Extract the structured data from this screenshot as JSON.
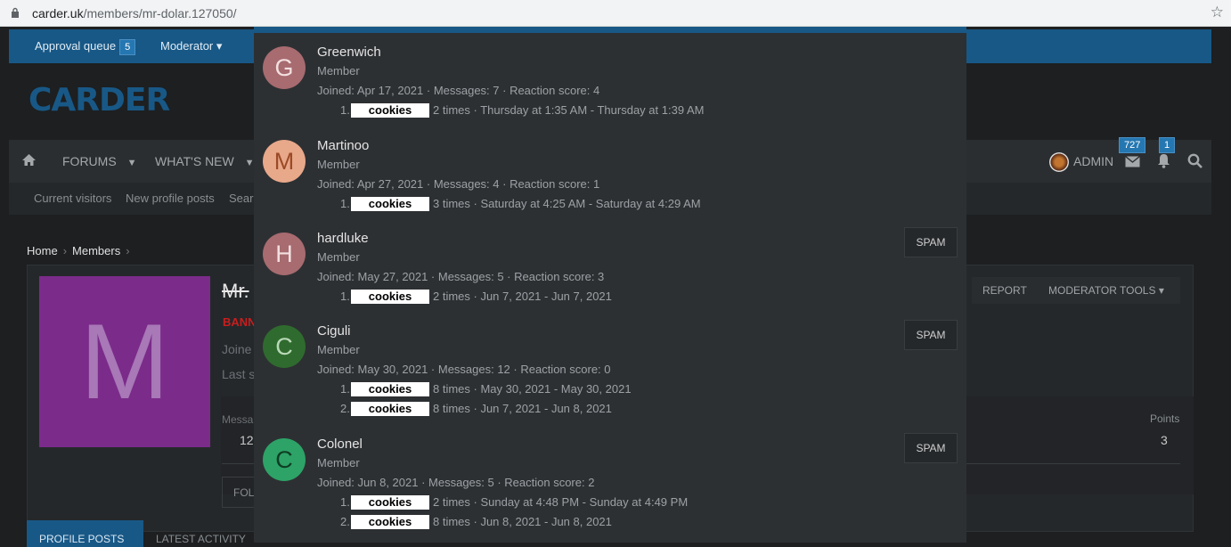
{
  "browser": {
    "url_host": "carder.uk",
    "url_path": "/members/mr-dolar.127050/"
  },
  "site": {
    "staff_bar": {
      "approval_queue_label": "Approval queue",
      "approval_queue_count": "5",
      "moderator_label": "Moderator"
    },
    "logo_text": "CARDER",
    "nav": {
      "forums": "FORUMS",
      "whats_new": "WHAT'S NEW",
      "user": "ADMIN",
      "inbox_count": "727",
      "alerts_count": "1"
    },
    "subnav": {
      "current_visitors": "Current visitors",
      "new_profile_posts": "New profile posts",
      "search_partial": "Sear"
    },
    "breadcrumb": {
      "home": "Home",
      "members": "Members"
    },
    "profile": {
      "avatar_letter": "M",
      "name_partial": "Mr.",
      "banned_partial": "BANN",
      "joined_partial": "Joine",
      "last_seen_partial": "Last s",
      "messages_partial": "Messa",
      "messages_value_partial": "12",
      "report_label": "REPORT",
      "moderator_tools_label": "MODERATOR TOOLS",
      "points_label": "Points",
      "points_value": "3",
      "follow_partial": "FOL",
      "tab_profile_posts": "PROFILE POSTS",
      "tab_latest_activity": "LATEST ACTIVITY"
    }
  },
  "overlay": {
    "spam_label": "SPAM",
    "cookie_label": "cookies",
    "members": [
      {
        "letter": "G",
        "avatar_bg": "#a76b70",
        "avatar_fg": "#f3dfe0",
        "name": "Greenwich",
        "title": "Member",
        "stats": "Joined: Apr 17, 2021 · Messages: 7 · Reaction score: 4",
        "spam": false,
        "cookies": [
          {
            "num": "1.",
            "detail": "2 times · Thursday at 1:35 AM - Thursday at 1:39 AM"
          }
        ]
      },
      {
        "letter": "M",
        "avatar_bg": "#e8a88a",
        "avatar_fg": "#9c4a26",
        "name": "Martinoo",
        "title": "Member",
        "stats": "Joined: Apr 27, 2021 · Messages: 4 · Reaction score: 1",
        "spam": false,
        "cookies": [
          {
            "num": "1.",
            "detail": "3 times · Saturday at 4:25 AM - Saturday at 4:29 AM"
          }
        ]
      },
      {
        "letter": "H",
        "avatar_bg": "#a76b70",
        "avatar_fg": "#f3dfe0",
        "name": "hardluke",
        "title": "Member",
        "stats": "Joined: May 27, 2021 · Messages: 5 · Reaction score: 3",
        "spam": true,
        "cookies": [
          {
            "num": "1.",
            "detail": "2 times · Jun 7, 2021 - Jun 7, 2021"
          }
        ]
      },
      {
        "letter": "C",
        "avatar_bg": "#2f6b2e",
        "avatar_fg": "#b9d9b8",
        "name": "Ciguli",
        "title": "Member",
        "stats": "Joined: May 30, 2021 · Messages: 12 · Reaction score: 0",
        "spam": true,
        "cookies": [
          {
            "num": "1.",
            "detail": "8 times · May 30, 2021 - May 30, 2021"
          },
          {
            "num": "2.",
            "detail": "8 times · Jun 7, 2021 - Jun 8, 2021"
          }
        ]
      },
      {
        "letter": "C",
        "avatar_bg": "#2da367",
        "avatar_fg": "#0e3d24",
        "name": "Colonel",
        "title": "Member",
        "stats": "Joined: Jun 8, 2021 · Messages: 5 · Reaction score: 2",
        "spam": true,
        "cookies": [
          {
            "num": "1.",
            "detail": "2 times · Sunday at 4:48 PM - Sunday at 4:49 PM"
          },
          {
            "num": "2.",
            "detail": "8 times · Jun 8, 2021 - Jun 8, 2021"
          }
        ]
      }
    ]
  }
}
